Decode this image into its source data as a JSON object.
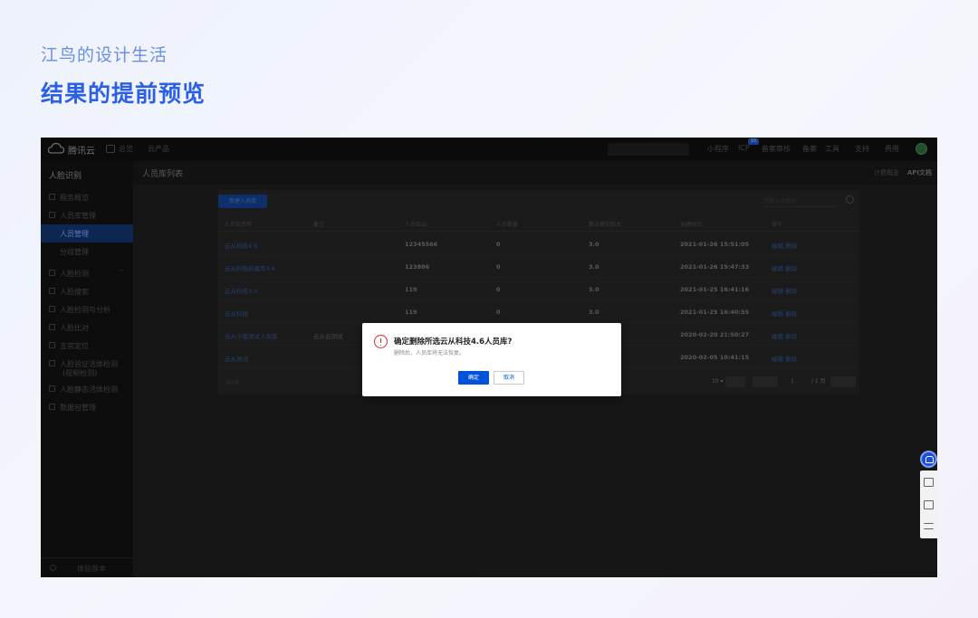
{
  "page": {
    "subtitle": "江鸟的设计生活",
    "title": "结果的提前预览"
  },
  "topnav": {
    "brand": "腾讯云",
    "home": "总览",
    "product": "云产品",
    "right": [
      "小程序",
      "ICP",
      "备案审核",
      "备案",
      "工具",
      "支持",
      "费用"
    ],
    "badge": "10"
  },
  "sidebar": {
    "title": "人脸识别",
    "items": [
      {
        "label": "服务概览"
      },
      {
        "label": "人员库管理"
      },
      {
        "label": "人员管理"
      },
      {
        "label": "分组管理"
      },
      {
        "label": "人脸检测"
      },
      {
        "label": "人脸搜索"
      },
      {
        "label": "人脸检测与分析"
      },
      {
        "label": "人脸比对"
      },
      {
        "label": "五官定位"
      },
      {
        "label": "人脸验证活体检测"
      },
      {
        "label": "(视频检测)"
      },
      {
        "label": "人脸静态活体检测"
      },
      {
        "label": "数据包管理"
      }
    ],
    "footer": "体验版本"
  },
  "content": {
    "page_title": "人员库列表",
    "links": [
      "计费概览",
      "API文档"
    ]
  },
  "panel": {
    "new_button": "新建人员库",
    "search_placeholder": "请输入关键词",
    "headers": [
      "人员库名称",
      "备注",
      "人员库ID",
      "人员数量",
      "算法模型版本",
      "创建时间",
      "操作"
    ],
    "rows": [
      {
        "name": "云从科技4.6",
        "note": "",
        "id": "12345566",
        "count": "0",
        "version": "3.0",
        "time": "2021-01-26 15:51:05",
        "ops": "编辑 删除"
      },
      {
        "name": "云从科技新建库4.6",
        "note": "",
        "id": "123886",
        "count": "0",
        "version": "3.0",
        "time": "2021-01-26 15:47:33",
        "ops": "编辑 删除"
      },
      {
        "name": "云从科技3.0",
        "note": "",
        "id": "119",
        "count": "0",
        "version": "3.0",
        "time": "2021-01-25 16:41:16",
        "ops": "编辑 删除"
      },
      {
        "name": "云从科技",
        "note": "",
        "id": "119",
        "count": "0",
        "version": "3.0",
        "time": "2021-01-25 16:40:55",
        "ops": "编辑 删除"
      },
      {
        "name": "云从小蜜测试人员库",
        "note": "云从云测试",
        "id": "",
        "count": "",
        "version": "",
        "time": "2020-02-20 21:50:27",
        "ops": "编辑 删除"
      },
      {
        "name": "云从测试",
        "note": "",
        "id": "",
        "count": "",
        "version": "",
        "time": "2020-02-05 10:41:15",
        "ops": "编辑 删除"
      }
    ],
    "pager": {
      "total": "共6项",
      "page_size": "10 ▾",
      "page": "1",
      "page_label": "/ 1 页"
    }
  },
  "modal": {
    "title": "确定删除所选云从科技4.6人员库?",
    "description": "删除后，人员库将无法恢复。",
    "ok": "确定",
    "cancel": "取消"
  },
  "colors": {
    "accent": "#0052d9",
    "warning": "#d83131",
    "title_blue": "#2a5fe6"
  }
}
